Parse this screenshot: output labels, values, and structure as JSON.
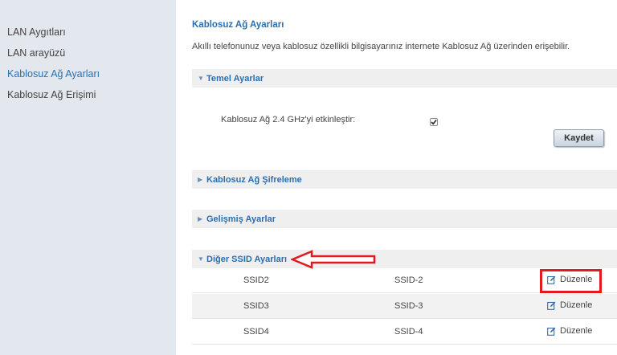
{
  "sidebar": {
    "items": [
      {
        "label": "LAN Aygıtları"
      },
      {
        "label": "LAN arayüzü"
      },
      {
        "label": "Kablosuz Ağ Ayarları"
      },
      {
        "label": "Kablosuz Ağ Erişimi"
      }
    ]
  },
  "main": {
    "title": "Kablosuz Ağ Ayarları",
    "description": "Akıllı telefonunuz veya kablosuz özellikli bilgisayarınız internete Kablosuz Ağ üzerinden erişebilir.",
    "sections": {
      "basic": {
        "title": "Temel Ayarlar",
        "enable_label": "Kablosuz Ağ 2.4 GHz'yi etkinleştir:",
        "enabled": true,
        "save_label": "Kaydet"
      },
      "encryption": {
        "title": "Kablosuz Ağ Şifreleme"
      },
      "advanced": {
        "title": "Gelişmiş Ayarlar"
      },
      "other_ssid": {
        "title": "Diğer SSID Ayarları"
      }
    },
    "ssid_rows": [
      {
        "name": "SSID2",
        "value": "SSID-2",
        "action": "Düzenle"
      },
      {
        "name": "SSID3",
        "value": "SSID-3",
        "action": "Düzenle"
      },
      {
        "name": "SSID4",
        "value": "SSID-4",
        "action": "Düzenle"
      }
    ]
  },
  "colors": {
    "accent": "#2a6fb0",
    "sidebar_bg": "#e3e8ee",
    "annotation": "#e2191e"
  },
  "icons": {
    "expanded": "caret-down-icon",
    "collapsed": "caret-right-icon",
    "edit": "edit-icon",
    "checkbox": "checkmark-icon"
  }
}
